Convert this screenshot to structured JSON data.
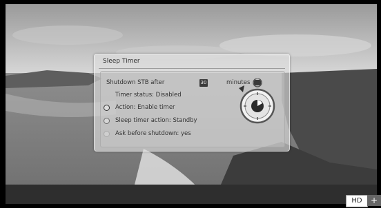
{
  "dialog": {
    "title": "Sleep Timer",
    "shutdown_label": "Shutdown STB after",
    "minutes_value": "30",
    "minutes_unit": "minutes",
    "timer_status": "Timer status: Disabled",
    "options": [
      {
        "label": "Action: Enable timer",
        "state": "selected"
      },
      {
        "label": "Sleep timer action: Standby",
        "state": "normal"
      },
      {
        "label": "Ask before shutdown: yes",
        "state": "faint"
      }
    ]
  },
  "badges": {
    "hd": "HD",
    "plus": "+"
  },
  "icons": {
    "timer": "stopwatch-icon"
  }
}
